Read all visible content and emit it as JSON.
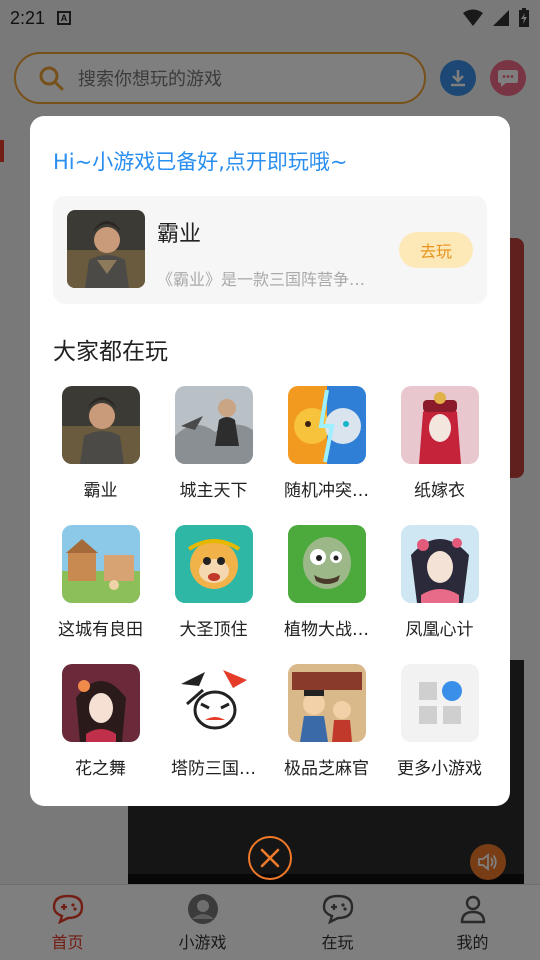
{
  "status_bar": {
    "time": "2:21",
    "a_badge": "A"
  },
  "search": {
    "placeholder": "搜索你想玩的游戏"
  },
  "colors": {
    "accent_orange": "#f0a032",
    "title_blue": "#2a8ff0",
    "tab_active": "#e53c2a"
  },
  "modal": {
    "title": "Hi~小游戏已备好,点开即玩哦~",
    "featured": {
      "name": "霸业",
      "description": "《霸业》是一款三国阵营争…",
      "play_label": "去玩",
      "icon": "warlord-portrait-icon"
    },
    "section_title": "大家都在玩",
    "games": [
      {
        "name": "霸业",
        "icon": "warlord-portrait-icon"
      },
      {
        "name": "城主天下",
        "icon": "city-lord-icon"
      },
      {
        "name": "随机冲突…",
        "icon": "random-clash-icon"
      },
      {
        "name": "纸嫁衣",
        "icon": "paper-bride-icon"
      },
      {
        "name": "这城有良田",
        "icon": "farm-town-icon"
      },
      {
        "name": "大圣顶住",
        "icon": "monkey-king-icon"
      },
      {
        "name": "植物大战…",
        "icon": "zombie-icon"
      },
      {
        "name": "凤凰心计",
        "icon": "phoenix-lady-icon"
      },
      {
        "name": "花之舞",
        "icon": "flower-dance-icon"
      },
      {
        "name": "塔防三国…",
        "icon": "tower-defense-icon"
      },
      {
        "name": "极品芝麻官",
        "icon": "sesame-official-icon"
      },
      {
        "name": "更多小游戏",
        "icon": "more-games-grid-icon"
      }
    ]
  },
  "tabs": [
    {
      "label": "首页",
      "icon": "gamepad-chat-icon",
      "active": true
    },
    {
      "label": "小游戏",
      "icon": "mini-game-avatar-icon",
      "active": false
    },
    {
      "label": "在玩",
      "icon": "gamepad-chat-icon",
      "active": false
    },
    {
      "label": "我的",
      "icon": "person-icon",
      "active": false
    }
  ]
}
